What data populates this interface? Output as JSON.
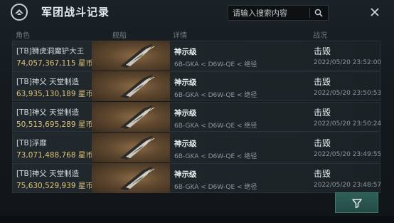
{
  "header": {
    "title": "军团战斗记录",
    "search_placeholder": "请输入搜索内容"
  },
  "columns": [
    "角色",
    "舰船",
    "详情",
    "战况"
  ],
  "rows": [
    {
      "name": "[TB]狮虎洞魔铲大王",
      "value": "74,057,367,115 星币",
      "detail": "神示级",
      "route": "6B-GKA < D6W-QE < 绝径",
      "status": "击毁",
      "time": "2022/05/20  23:52:00"
    },
    {
      "name": "[TB]神父 天堂制造",
      "value": "63,935,130,189 星币",
      "detail": "神示级",
      "route": "6B-GKA < D6W-QE < 绝径",
      "status": "击毁",
      "time": "2022/05/20  23:50:53"
    },
    {
      "name": "[TB]神父 天堂制造",
      "value": "50,513,695,289 星币",
      "detail": "神示级",
      "route": "6B-GKA < D6W-QE < 绝径",
      "status": "击毁",
      "time": "2022/05/20  23:50:24"
    },
    {
      "name": "[TB]浮靡",
      "value": "73,071,488,768 星币",
      "detail": "神示级",
      "route": "6B-GKA < D6W-QE < 绝径",
      "status": "击毁",
      "time": "2022/05/20  23:49:55"
    },
    {
      "name": "[TB]神父 天堂制造",
      "value": "75,630,529,939 星币",
      "detail": "神示级",
      "route": "6B-GKA < D6W-QE < 绝径",
      "status": "击毁",
      "time": "2022/05/20  23:48:57"
    }
  ],
  "icons": {
    "logo": "legion-emblem-icon",
    "search": "search-icon",
    "close": "close-icon",
    "filter": "filter-icon",
    "ship": "ship-thumbnail"
  },
  "colors": {
    "value": "#e0c27a",
    "filter_button": "#2f5f5a"
  }
}
